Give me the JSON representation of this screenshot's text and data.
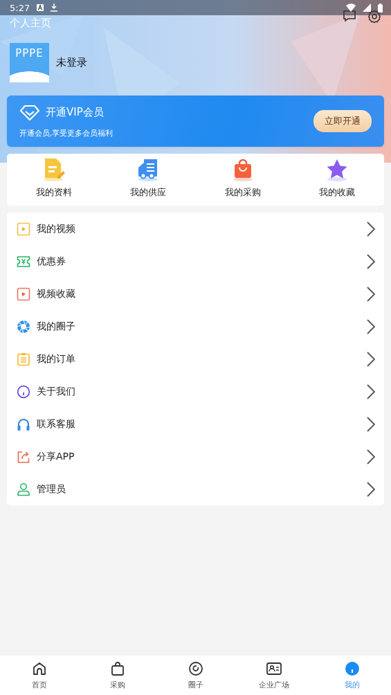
{
  "status_bar": {
    "time": "5:27"
  },
  "header": {
    "title": "个人主页",
    "user_name": "未登录",
    "logo_text": "PPPE"
  },
  "vip": {
    "title": "开通VIP会员",
    "subtitle": "开通会员,享受更多会员福利",
    "button": "立即开通"
  },
  "quick_links": [
    {
      "label": "我的资料",
      "kind": "doc"
    },
    {
      "label": "我的供应",
      "kind": "truck"
    },
    {
      "label": "我的采购",
      "kind": "bag"
    },
    {
      "label": "我的收藏",
      "kind": "star"
    }
  ],
  "menu": [
    {
      "label": "我的视频",
      "kind": "video"
    },
    {
      "label": "优惠券",
      "kind": "coupon"
    },
    {
      "label": "视频收藏",
      "kind": "video-fav"
    },
    {
      "label": "我的圈子",
      "kind": "aperture"
    },
    {
      "label": "我的订单",
      "kind": "order"
    },
    {
      "label": "关于我们",
      "kind": "info"
    },
    {
      "label": "联系客服",
      "kind": "headset"
    },
    {
      "label": "分享APP",
      "kind": "share"
    },
    {
      "label": "管理员",
      "kind": "admin"
    }
  ],
  "tabs": [
    {
      "label": "首页",
      "kind": "home",
      "selected": false
    },
    {
      "label": "采购",
      "kind": "bag",
      "selected": false
    },
    {
      "label": "圈子",
      "kind": "circle",
      "selected": false
    },
    {
      "label": "企业广场",
      "kind": "card",
      "selected": false
    },
    {
      "label": "我的",
      "kind": "me",
      "selected": true
    }
  ]
}
